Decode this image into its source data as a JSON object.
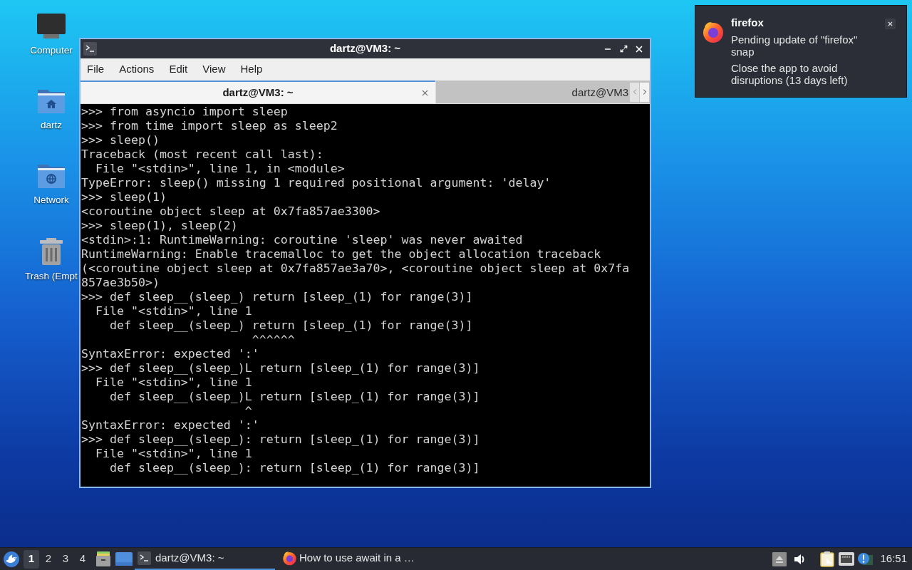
{
  "desktop": {
    "icons": [
      {
        "label": "Computer",
        "kind": "computer"
      },
      {
        "label": "dartz",
        "kind": "home"
      },
      {
        "label": "Network",
        "kind": "network"
      },
      {
        "label": "Trash (Empt",
        "kind": "trash"
      }
    ]
  },
  "terminal_window": {
    "title": "dartz@VM3: ~",
    "menu": [
      "File",
      "Actions",
      "Edit",
      "View",
      "Help"
    ],
    "tabs": [
      {
        "label": "dartz@VM3: ~",
        "selected": true
      },
      {
        "label": "dartz@VM3",
        "selected": false
      }
    ],
    "lines": [
      ">>> from asyncio import sleep",
      ">>> from time import sleep as sleep2",
      ">>> sleep()",
      "Traceback (most recent call last):",
      "  File \"<stdin>\", line 1, in <module>",
      "TypeError: sleep() missing 1 required positional argument: 'delay'",
      ">>> sleep(1)",
      "<coroutine object sleep at 0x7fa857ae3300>",
      ">>> sleep(1), sleep(2)",
      "<stdin>:1: RuntimeWarning: coroutine 'sleep' was never awaited",
      "RuntimeWarning: Enable tracemalloc to get the object allocation traceback",
      "(<coroutine object sleep at 0x7fa857ae3a70>, <coroutine object sleep at 0x7fa",
      "857ae3b50>)",
      ">>> def sleep__(sleep_) return [sleep_(1) for range(3)]",
      "  File \"<stdin>\", line 1",
      "    def sleep__(sleep_) return [sleep_(1) for range(3)]",
      "                        ^^^^^^",
      "SyntaxError: expected ':'",
      ">>> def sleep__(sleep_)L return [sleep_(1) for range(3)]",
      "  File \"<stdin>\", line 1",
      "    def sleep__(sleep_)L return [sleep_(1) for range(3)]",
      "                       ^",
      "SyntaxError: expected ':'",
      ">>> def sleep__(sleep_): return [sleep_(1) for range(3)]",
      "  File \"<stdin>\", line 1",
      "    def sleep__(sleep_): return [sleep_(1) for range(3)]"
    ]
  },
  "notification": {
    "app": "firefox",
    "messages": [
      "Pending update of \"firefox\" snap",
      "Close the app to avoid disruptions (13 days left)"
    ]
  },
  "taskbar": {
    "workspaces": [
      {
        "label": "1",
        "selected": true
      },
      {
        "label": "2",
        "selected": false
      },
      {
        "label": "3",
        "selected": false
      },
      {
        "label": "4",
        "selected": false
      }
    ],
    "tasks": [
      {
        "label": "dartz@VM3: ~",
        "kind": "terminal",
        "selected": true
      },
      {
        "label": "How to use await in a …",
        "kind": "browser",
        "selected": false
      }
    ],
    "clock": "16:51"
  }
}
